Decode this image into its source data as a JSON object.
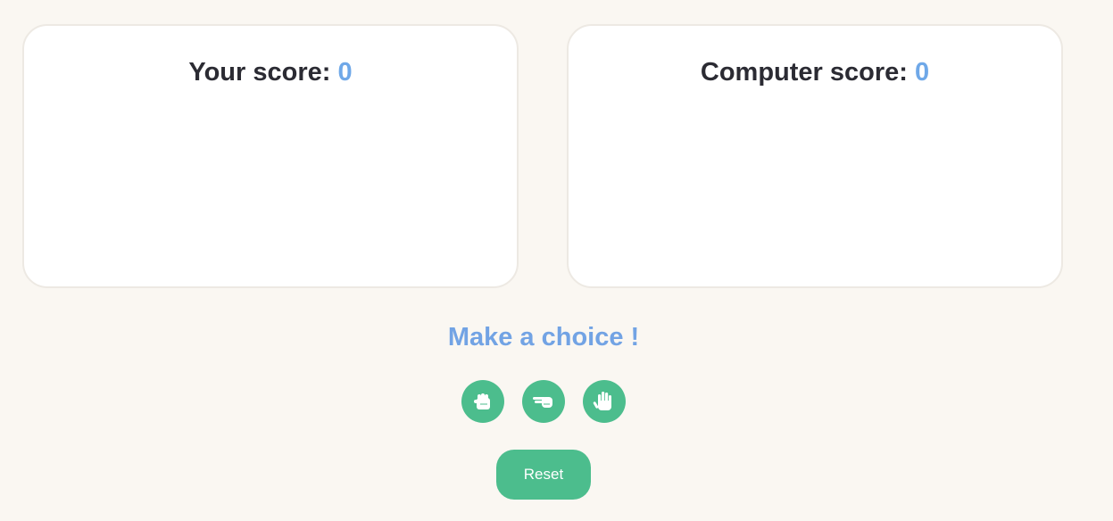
{
  "player": {
    "label": "Your score: ",
    "score": "0"
  },
  "computer": {
    "label": "Computer score: ",
    "score": "0"
  },
  "prompt": "Make a choice !",
  "choices": [
    {
      "icon": "rock-fist-icon"
    },
    {
      "icon": "scissors-hand-icon"
    },
    {
      "icon": "paper-hand-icon"
    }
  ],
  "reset_label": "Reset",
  "colors": {
    "background": "#faf7f2",
    "accent_green": "#4cbd8d",
    "score_blue": "#6fa8e8",
    "title_dark": "#2b2b33"
  }
}
